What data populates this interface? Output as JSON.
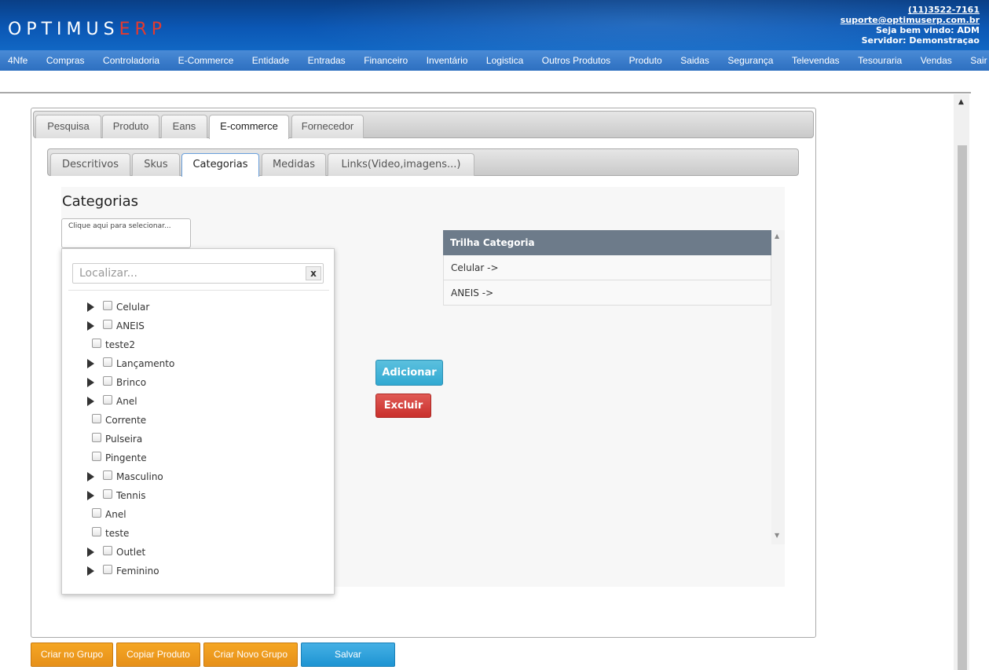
{
  "header": {
    "logo_main": "OPTIMUS",
    "logo_accent": "ERP",
    "phone": "(11)3522-7161",
    "email": "suporte@optimuserp.com.br",
    "welcome": "Seja bem vindo: ADM",
    "server": "Servidor: Demonstraçao"
  },
  "nav": {
    "items": [
      "4Nfe",
      "Compras",
      "Controladoria",
      "E-Commerce",
      "Entidade",
      "Entradas",
      "Financeiro",
      "Inventário",
      "Logistica",
      "Outros Produtos",
      "Produto",
      "Saidas",
      "Segurança",
      "Televendas",
      "Tesouraria",
      "Vendas",
      "Sair"
    ]
  },
  "tabs": [
    "Pesquisa",
    "Produto",
    "Eans",
    "E-commerce",
    "Fornecedor"
  ],
  "subtabs": [
    "Descritivos",
    "Skus",
    "Categorias",
    "Medidas",
    "Links(Video,imagens...)"
  ],
  "categorias": {
    "title": "Categorias",
    "selector_text": "Clique aqui para selecionar...",
    "search_placeholder": "Localizar...",
    "clear_label": "x",
    "tree": [
      {
        "label": "Celular",
        "expandable": true
      },
      {
        "label": "ANEIS",
        "expandable": true
      },
      {
        "label": "teste2",
        "expandable": false
      },
      {
        "label": "Lançamento",
        "expandable": true
      },
      {
        "label": "Brinco",
        "expandable": true
      },
      {
        "label": "Anel",
        "expandable": true
      },
      {
        "label": "Corrente",
        "expandable": false
      },
      {
        "label": "Pulseira",
        "expandable": false
      },
      {
        "label": "Pingente",
        "expandable": false
      },
      {
        "label": "Masculino",
        "expandable": true
      },
      {
        "label": "Tennis",
        "expandable": true
      },
      {
        "label": "Anel",
        "expandable": false
      },
      {
        "label": "teste",
        "expandable": false
      },
      {
        "label": "Outlet",
        "expandable": true
      },
      {
        "label": "Feminino",
        "expandable": true
      }
    ],
    "add_label": "Adicionar",
    "delete_label": "Excluir",
    "trail_header": "Trilha Categoria",
    "trail_rows": [
      "Celular ->",
      "ANEIS ->"
    ]
  },
  "footer": {
    "btn_create_group": "Criar no Grupo",
    "btn_copy": "Copiar Produto",
    "btn_new_group": "Criar Novo Grupo",
    "btn_save": "Salvar"
  }
}
